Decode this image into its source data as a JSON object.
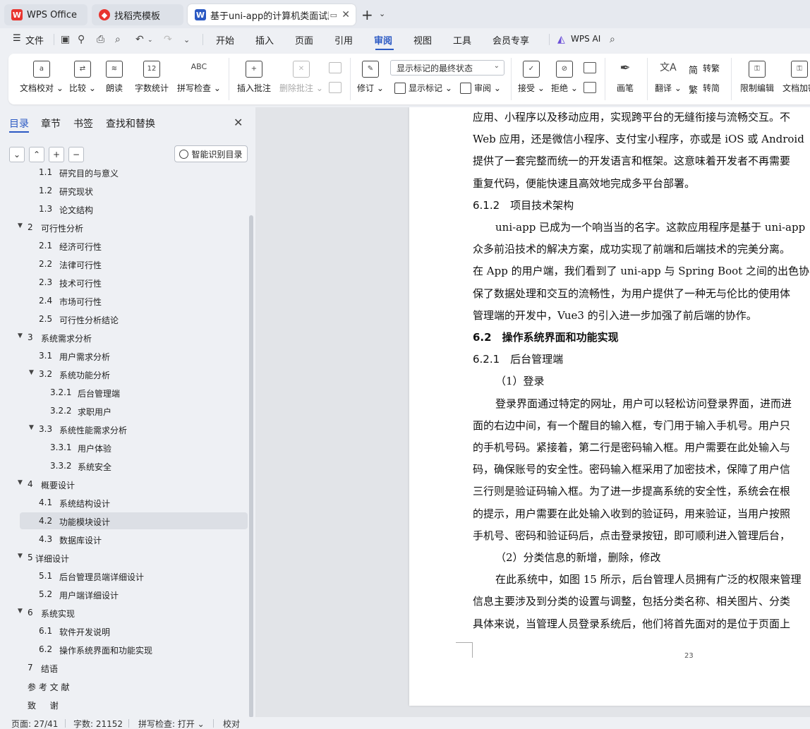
{
  "tabs": [
    {
      "label": "WPS Office",
      "icon": "wps-logo-icon",
      "color": "#e8342e"
    },
    {
      "label": "找稻壳模板",
      "icon": "docer-logo-icon",
      "color": "#e8342e"
    },
    {
      "label": "基于uni-app的计算机类面试题",
      "icon": "writer-doc-icon",
      "color": "#2b59c3"
    }
  ],
  "menubar": {
    "file": "文件",
    "items": [
      "开始",
      "插入",
      "页面",
      "引用",
      "审阅",
      "视图",
      "工具",
      "会员专享"
    ],
    "active": "审阅",
    "wps_ai": "WPS AI"
  },
  "ribbon": {
    "doc_check": "文档校对",
    "compare": "比较",
    "read_aloud": "朗读",
    "word_count": "字数统计",
    "spell_check": "拼写检查",
    "spell_check_top": "ABC",
    "word_count_top": "12",
    "insert_comment": "插入批注",
    "delete_comment": "删除批注",
    "revise": "修订",
    "markup_mode": "显示标记的最终状态",
    "show_markup": "显示标记",
    "review": "审阅",
    "accept": "接受",
    "reject": "拒绝",
    "pen": "画笔",
    "translate": "翻译",
    "to_traditional": "转繁",
    "to_simplified": "转简",
    "restrict_edit": "限制编辑",
    "doc_encrypt": "文档加密"
  },
  "panel": {
    "tabs": [
      "目录",
      "章节",
      "书签",
      "查找和替换"
    ],
    "active_tab": "目录",
    "smart_toc": "智能识别目录",
    "controls": [
      "⌄",
      "⌃",
      "+",
      "−"
    ]
  },
  "toc": [
    {
      "num": "1.1",
      "label": "研究目的与意义",
      "level": 2
    },
    {
      "num": "1.2",
      "label": "研究现状",
      "level": 2
    },
    {
      "num": "1.3",
      "label": "论文结构",
      "level": 2
    },
    {
      "num": "2",
      "label": "可行性分析",
      "level": 1
    },
    {
      "num": "2.1",
      "label": "经济可行性",
      "level": 2
    },
    {
      "num": "2.2",
      "label": "法律可行性",
      "level": 2
    },
    {
      "num": "2.3",
      "label": "技术可行性",
      "level": 2
    },
    {
      "num": "2.4",
      "label": "市场可行性",
      "level": 2
    },
    {
      "num": "2.5",
      "label": "可行性分析结论",
      "level": 2
    },
    {
      "num": "3",
      "label": "系统需求分析",
      "level": 1
    },
    {
      "num": "3.1",
      "label": "用户需求分析",
      "level": 2
    },
    {
      "num": "3.2",
      "label": "系统功能分析",
      "level": 2,
      "expand": true
    },
    {
      "num": "3.2.1",
      "label": "后台管理端",
      "level": 3
    },
    {
      "num": "3.2.2",
      "label": "求职用户",
      "level": 3
    },
    {
      "num": "3.3",
      "label": "系统性能需求分析",
      "level": 2,
      "expand": true
    },
    {
      "num": "3.3.1",
      "label": "用户体验",
      "level": 3
    },
    {
      "num": "3.3.2",
      "label": "系统安全",
      "level": 3
    },
    {
      "num": "4",
      "label": "概要设计",
      "level": 1
    },
    {
      "num": "4.1",
      "label": "系统结构设计",
      "level": 2
    },
    {
      "num": "4.2",
      "label": "功能模块设计",
      "level": 2,
      "selected": true
    },
    {
      "num": "4.3",
      "label": "数据库设计",
      "level": 2
    },
    {
      "num": "5",
      "label": "详细设计",
      "level": 1,
      "tight": true
    },
    {
      "num": "5.1",
      "label": "后台管理员端详细设计",
      "level": 2
    },
    {
      "num": "5.2",
      "label": "用户端详细设计",
      "level": 2
    },
    {
      "num": "6",
      "label": "系统实现",
      "level": 1
    },
    {
      "num": "6.1",
      "label": "软件开发说明",
      "level": 2
    },
    {
      "num": "6.2",
      "label": "操作系统界面和功能实现",
      "level": 2
    },
    {
      "num": "7",
      "label": "结语",
      "level": 0
    },
    {
      "num": "",
      "label": "参 考 文 献",
      "level": 0
    },
    {
      "num": "",
      "label": "致 　 谢",
      "level": 0
    }
  ],
  "document": {
    "lines": [
      {
        "text": "应用、小程序以及移动应用，实现跨平台的无缝衔接与流畅交互。不",
        "type": "body"
      },
      {
        "text": "Web 应用，还是微信小程序、支付宝小程序，亦或是 iOS 或 Android",
        "type": "body"
      },
      {
        "text": "提供了一套完整而统一的开发语言和框架。这意味着开发者不再需要",
        "type": "body"
      },
      {
        "text": "重复代码，便能快速且高效地完成多平台部署。",
        "type": "body"
      },
      {
        "text": "6.1.2　项目技术架构",
        "type": "sub"
      },
      {
        "text": "uni-app 已成为一个响当当的名字。这款应用程序是基于 uni-app",
        "type": "indent"
      },
      {
        "text": "众多前沿技术的解决方案，成功实现了前端和后端技术的完美分离。",
        "type": "body"
      },
      {
        "text": "在 App 的用户端，我们看到了 uni-app 与 Spring Boot 之间的出色协同",
        "type": "body"
      },
      {
        "text": "保了数据处理和交互的流畅性，为用户提供了一种无与伦比的使用体",
        "type": "body"
      },
      {
        "text": "管理端的开发中，Vue3 的引入进一步加强了前后端的协作。",
        "type": "body"
      },
      {
        "text": "6.2　操作系统界面和功能实现",
        "type": "head"
      },
      {
        "text": "6.2.1　后台管理端",
        "type": "sub"
      },
      {
        "text": "（1）登录",
        "type": "indent"
      },
      {
        "text": "登录界面通过特定的网址，用户可以轻松访问登录界面，进而进",
        "type": "indent"
      },
      {
        "text": "面的右边中间，有一个醒目的输入框，专门用于输入手机号。用户只",
        "type": "body"
      },
      {
        "text": "的手机号码。紧接着，第二行是密码输入框。用户需要在此处输入与",
        "type": "body"
      },
      {
        "text": "码，确保账号的安全性。密码输入框采用了加密技术，保障了用户信",
        "type": "body"
      },
      {
        "text": "三行则是验证码输入框。为了进一步提高系统的安全性，系统会在根",
        "type": "body"
      },
      {
        "text": "的提示，用户需要在此处输入收到的验证码，用来验证，当用户按照",
        "type": "body"
      },
      {
        "text": "手机号、密码和验证码后，点击登录按钮，即可顺利进入管理后台，",
        "type": "body"
      },
      {
        "text": "（2）分类信息的新增，删除，修改",
        "type": "indent"
      },
      {
        "text": "在此系统中，如图 15 所示，后台管理人员拥有广泛的权限来管理",
        "type": "indent"
      },
      {
        "text": "信息主要涉及到分类的设置与调整，包括分类名称、相关图片、分类",
        "type": "body"
      },
      {
        "text": "具体来说，当管理人员登录系统后，他们将首先面对的是位于页面上",
        "type": "body"
      }
    ],
    "page_number": "23"
  },
  "statusbar": {
    "page": "页面: 27/41",
    "words": "字数: 21152",
    "spell": "拼写检查: 打开",
    "proof": "校对"
  }
}
